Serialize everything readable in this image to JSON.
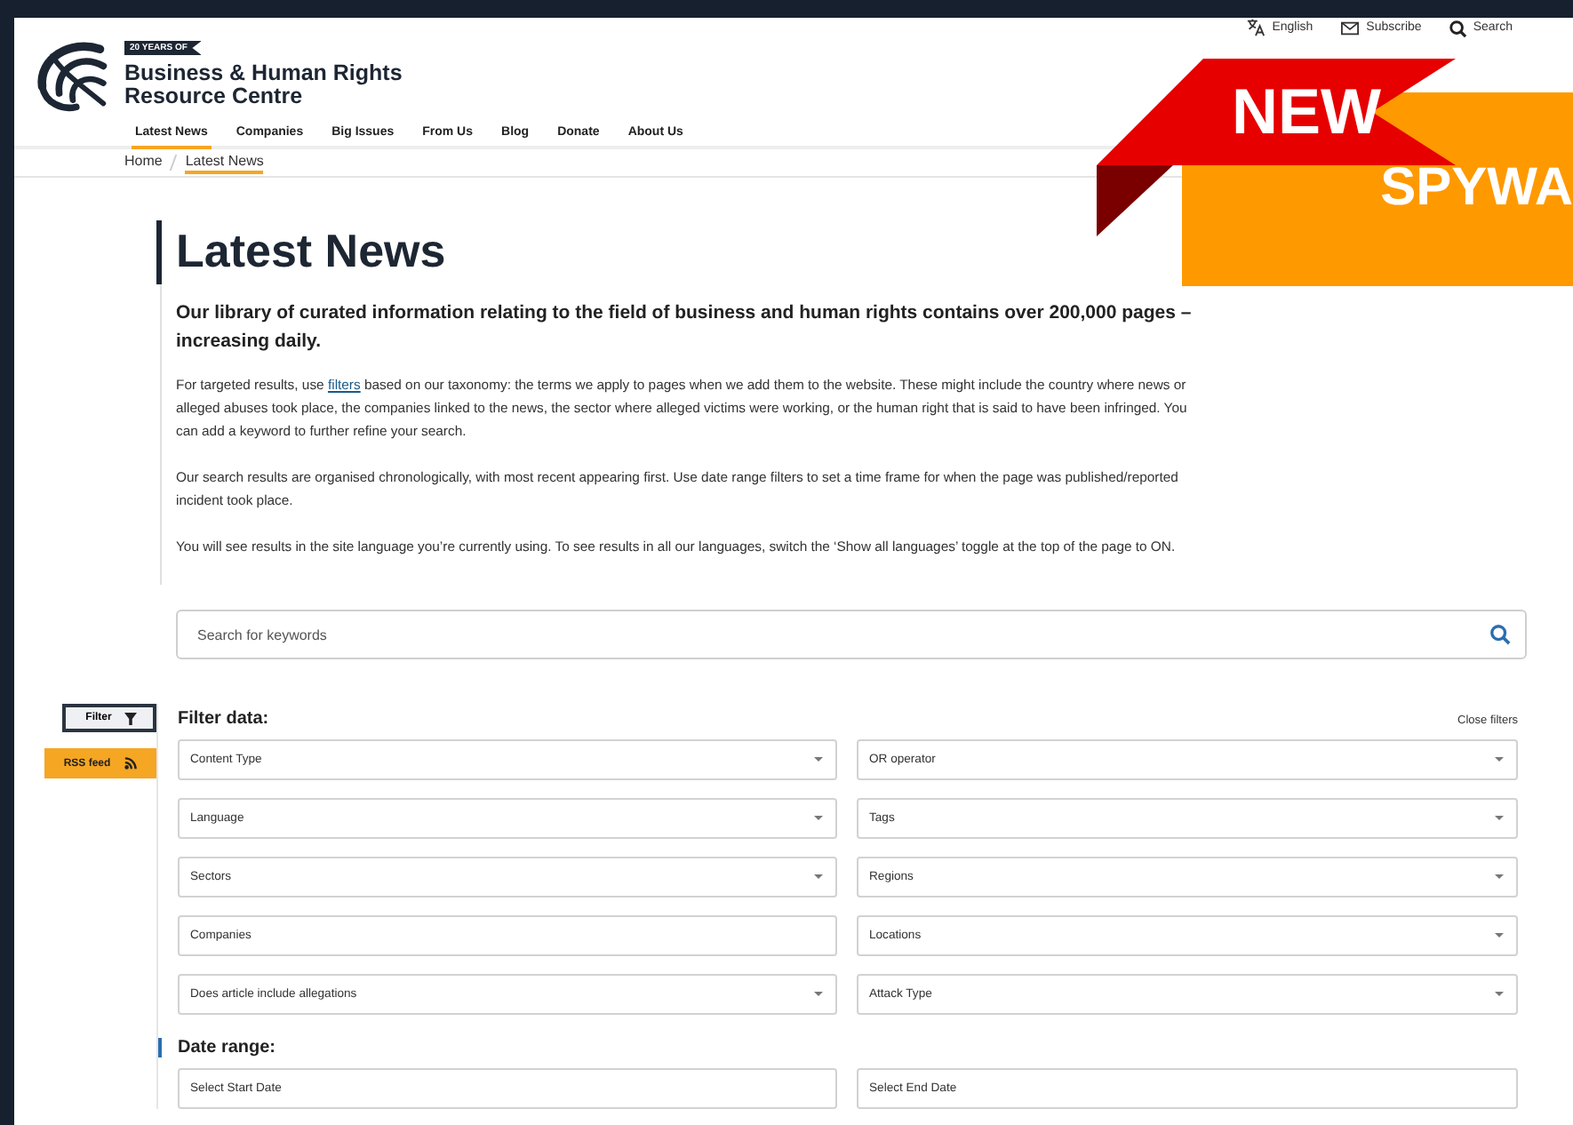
{
  "utility_links": [
    {
      "label": "English",
      "kind": "language"
    },
    {
      "label": "Subscribe",
      "kind": "mail"
    },
    {
      "label": "Search",
      "kind": "search"
    }
  ],
  "logo": {
    "badge": "20 YEARS OF",
    "name_line_1": "Business & Human Rights",
    "name_line_2": "Resource Centre"
  },
  "nav": [
    {
      "label": "Latest News",
      "selected": true
    },
    {
      "label": "Companies",
      "selected": false
    },
    {
      "label": "Big Issues",
      "selected": false
    },
    {
      "label": "From Us",
      "selected": false
    },
    {
      "label": "Blog",
      "selected": false
    },
    {
      "label": "Donate",
      "selected": false
    },
    {
      "label": "About Us",
      "selected": false
    }
  ],
  "breadcrumb": [
    {
      "label": "Home",
      "current": false
    },
    {
      "label": "Latest News",
      "current": true
    }
  ],
  "title": "Latest News",
  "intro": "Our library of curated information relating to the field of business and human rights contains over 200,000 pages – increasing daily.",
  "paragraphs": [
    {
      "text_before": "For targeted results, use ",
      "link": "filters",
      "text_after": " based on our taxonomy: the terms we apply to pages when we add them to the website. These might include the country where news or alleged abuses took place, the companies linked to the news, the sector where alleged victims were working, or the human right that is said to have been infringed. You can add a keyword to further refine your search."
    },
    {
      "text_before": "Our search results are organised chronologically, with most recent appearing first. Use date range filters to set a time frame for when the page was published/reported incident took place."
    },
    {
      "text_before": "You will see results in the site language you’re currently using. To see results in all our languages, switch the ‘Show all languages’ toggle at the top of the page to ON."
    }
  ],
  "search": {
    "placeholder": "Search for keywords"
  },
  "sidebar": {
    "filter_button": "Filter",
    "rss_button": "RSS feed"
  },
  "filter_heading": "Filter data:",
  "close_filters": "Close filters",
  "filters": [
    {
      "placeholder": "Content Type",
      "kind": "dropdown"
    },
    {
      "placeholder": "OR operator",
      "kind": "dropdown"
    },
    {
      "placeholder": "Language",
      "kind": "dropdown"
    },
    {
      "placeholder": "Tags",
      "kind": "dropdown"
    },
    {
      "placeholder": "Sectors",
      "kind": "dropdown"
    },
    {
      "placeholder": "Regions",
      "kind": "dropdown"
    },
    {
      "placeholder": "Companies",
      "kind": "text"
    },
    {
      "placeholder": "Locations",
      "kind": "dropdown"
    },
    {
      "placeholder": "Does article include allegations",
      "kind": "dropdown"
    },
    {
      "placeholder": "Attack Type",
      "kind": "dropdown"
    }
  ],
  "date_heading": "Date range:",
  "date_fields": [
    {
      "placeholder": "Select Start Date"
    },
    {
      "placeholder": "Select End Date"
    }
  ],
  "banner": {
    "ribbon": "NEW",
    "label": "SPYWA"
  }
}
